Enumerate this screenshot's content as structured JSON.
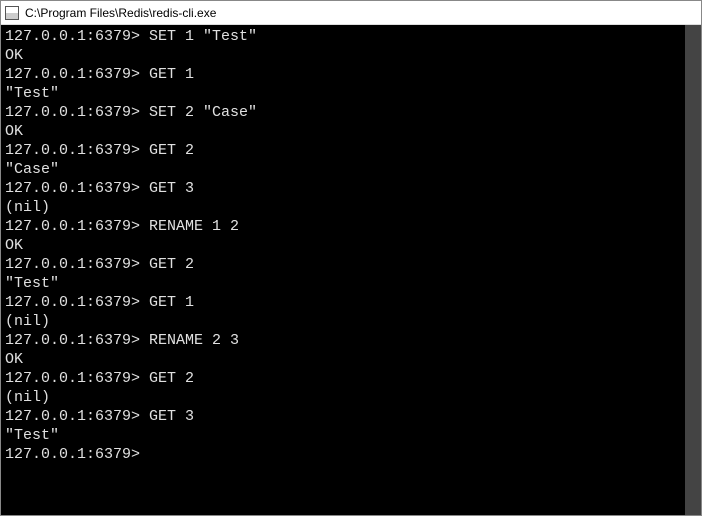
{
  "window": {
    "title": "C:\\Program Files\\Redis\\redis-cli.exe"
  },
  "terminal": {
    "prompt": "127.0.0.1:6379>",
    "lines": [
      {
        "type": "cmd",
        "text": "SET 1 \"Test\""
      },
      {
        "type": "out",
        "text": "OK"
      },
      {
        "type": "cmd",
        "text": "GET 1"
      },
      {
        "type": "out",
        "text": "\"Test\""
      },
      {
        "type": "cmd",
        "text": "SET 2 \"Case\""
      },
      {
        "type": "out",
        "text": "OK"
      },
      {
        "type": "cmd",
        "text": "GET 2"
      },
      {
        "type": "out",
        "text": "\"Case\""
      },
      {
        "type": "cmd",
        "text": "GET 3"
      },
      {
        "type": "out",
        "text": "(nil)"
      },
      {
        "type": "cmd",
        "text": "RENAME 1 2"
      },
      {
        "type": "out",
        "text": "OK"
      },
      {
        "type": "cmd",
        "text": "GET 2"
      },
      {
        "type": "out",
        "text": "\"Test\""
      },
      {
        "type": "cmd",
        "text": "GET 1"
      },
      {
        "type": "out",
        "text": "(nil)"
      },
      {
        "type": "cmd",
        "text": "RENAME 2 3"
      },
      {
        "type": "out",
        "text": "OK"
      },
      {
        "type": "cmd",
        "text": "GET 2"
      },
      {
        "type": "out",
        "text": "(nil)"
      },
      {
        "type": "cmd",
        "text": "GET 3"
      },
      {
        "type": "out",
        "text": "\"Test\""
      },
      {
        "type": "cmd",
        "text": ""
      }
    ]
  }
}
